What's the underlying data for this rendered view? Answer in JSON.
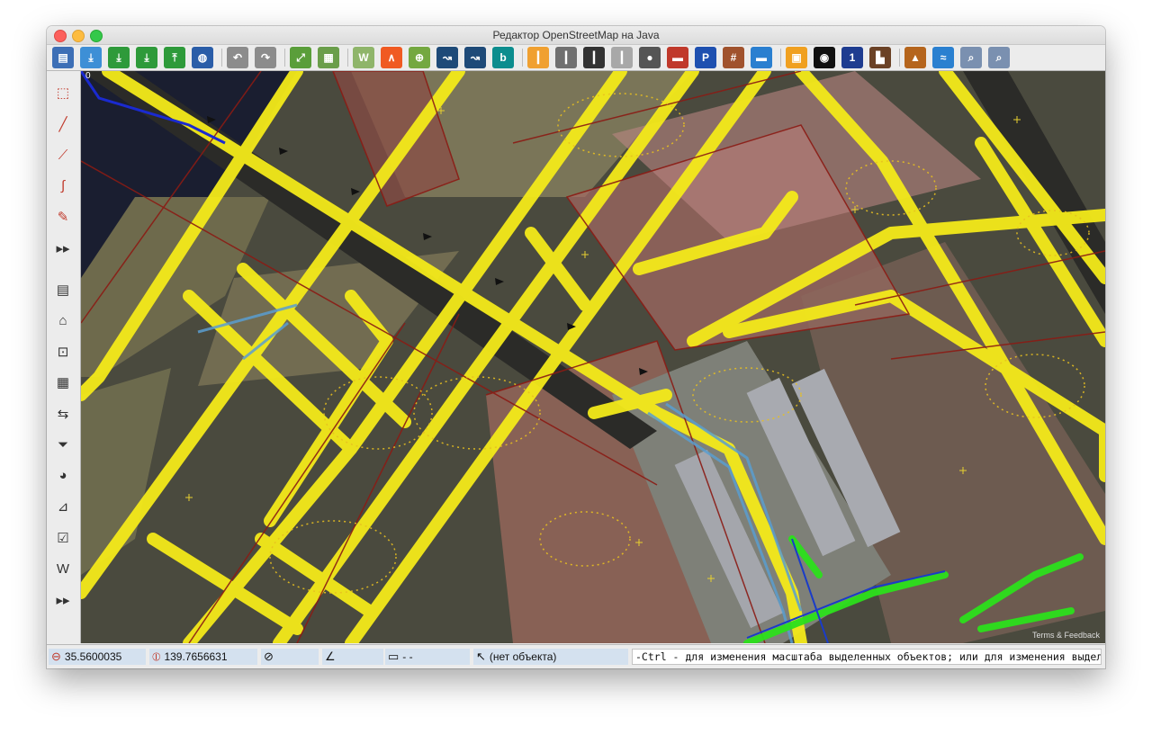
{
  "window": {
    "title": "Редактор OpenStreetMap на Java"
  },
  "toolbar": {
    "buttons": [
      {
        "name": "open-file-icon",
        "color": "#3d6fb6",
        "glyph": "▤"
      },
      {
        "name": "save-icon",
        "color": "#3d8fd6",
        "glyph": "⤓"
      },
      {
        "name": "download-icon",
        "color": "#2e9a3a",
        "glyph": "⤓"
      },
      {
        "name": "download-area-icon",
        "color": "#2e9a3a",
        "glyph": "⤓"
      },
      {
        "name": "upload-icon",
        "color": "#2e9a3a",
        "glyph": "⤒"
      },
      {
        "name": "preferences-globe-icon",
        "color": "#2a5da8",
        "glyph": "◍"
      },
      {
        "name": "undo-icon",
        "color": "#8c8c8c",
        "glyph": "↶"
      },
      {
        "name": "redo-icon",
        "color": "#8c8c8c",
        "glyph": "↷"
      },
      {
        "name": "zoom-to-data-icon",
        "color": "#5a9e3a",
        "glyph": "⤢"
      },
      {
        "name": "layer-imagery-icon",
        "color": "#6a9e4a",
        "glyph": "▦"
      },
      {
        "name": "wms-tms-icon",
        "color": "#8fb56a",
        "glyph": "W"
      },
      {
        "name": "strava-icon",
        "color": "#f05a22",
        "glyph": "∧"
      },
      {
        "name": "zoom-in-icon",
        "color": "#74a840",
        "glyph": "⊕"
      },
      {
        "name": "imagery-alignment-icon",
        "color": "#1e4a78",
        "glyph": "↝"
      },
      {
        "name": "imagery-offset-icon",
        "color": "#1e4a78",
        "glyph": "↝"
      },
      {
        "name": "bing-icon",
        "color": "#0c8d8e",
        "glyph": "b"
      },
      {
        "name": "road-orange-icon",
        "color": "#f0a030",
        "glyph": "┃"
      },
      {
        "name": "road-grey-icon",
        "color": "#707070",
        "glyph": "┃"
      },
      {
        "name": "road-dark-icon",
        "color": "#333333",
        "glyph": "┃"
      },
      {
        "name": "road-lightgrey-icon",
        "color": "#a8a8a8",
        "glyph": "┃"
      },
      {
        "name": "traffic-light-icon",
        "color": "#555555",
        "glyph": "●"
      },
      {
        "name": "wall-icon",
        "color": "#c0392b",
        "glyph": "▬"
      },
      {
        "name": "parking-icon",
        "color": "#1e50b0",
        "glyph": "P"
      },
      {
        "name": "railway-icon",
        "color": "#a0522d",
        "glyph": "#"
      },
      {
        "name": "bed-hotel-icon",
        "color": "#2a7fd0",
        "glyph": "▬"
      },
      {
        "name": "shopping-bag-icon",
        "color": "#f0a020",
        "glyph": "▣"
      },
      {
        "name": "football-icon",
        "color": "#111111",
        "glyph": "◉"
      },
      {
        "name": "number-one-icon",
        "color": "#1e3c90",
        "glyph": "1"
      },
      {
        "name": "industrial-icon",
        "color": "#6b4226",
        "glyph": "▙"
      },
      {
        "name": "peak-icon",
        "color": "#b5651d",
        "glyph": "▲"
      },
      {
        "name": "waterway-icon",
        "color": "#2a80d0",
        "glyph": "≈"
      },
      {
        "name": "search-map-icon",
        "color": "#7a90b0",
        "glyph": "⌕"
      },
      {
        "name": "search-map-2-icon",
        "color": "#7a90b0",
        "glyph": "⌕"
      }
    ]
  },
  "sidebar": {
    "tools": [
      {
        "name": "select-tool-icon",
        "glyph": "⬚"
      },
      {
        "name": "draw-line-icon",
        "glyph": "╱"
      },
      {
        "name": "draw-nodes-icon",
        "glyph": "⟋"
      },
      {
        "name": "improve-way-icon",
        "glyph": "∫"
      },
      {
        "name": "pencil-icon",
        "glyph": "✎"
      },
      {
        "name": "more-tools-icon",
        "glyph": "▸▸"
      },
      {
        "name": "layers-icon",
        "glyph": "▤"
      },
      {
        "name": "tag-icon",
        "glyph": "⌂"
      },
      {
        "name": "relation-icon",
        "glyph": "⊡"
      },
      {
        "name": "history-icon",
        "glyph": "▦"
      },
      {
        "name": "conflict-icon",
        "glyph": "⇆"
      },
      {
        "name": "filter-icon",
        "glyph": "⏷"
      },
      {
        "name": "map-paint-style-icon",
        "glyph": "◕"
      },
      {
        "name": "validation-icon",
        "glyph": "⊿"
      },
      {
        "name": "checklist-icon",
        "glyph": "☑"
      },
      {
        "name": "wikipedia-icon",
        "glyph": "W"
      },
      {
        "name": "more-panels-icon",
        "glyph": "▸▸"
      }
    ]
  },
  "map": {
    "scale_label": "0",
    "attribution": "Terms & Feedback"
  },
  "status": {
    "lat": "35.5600035",
    "lon": "139.7656631",
    "heading": "",
    "angle": "",
    "distance": "- -",
    "object": "(нет объекта)",
    "message": "-Ctrl - для изменения масштаба выделенных объектов; или для изменения выделения"
  }
}
